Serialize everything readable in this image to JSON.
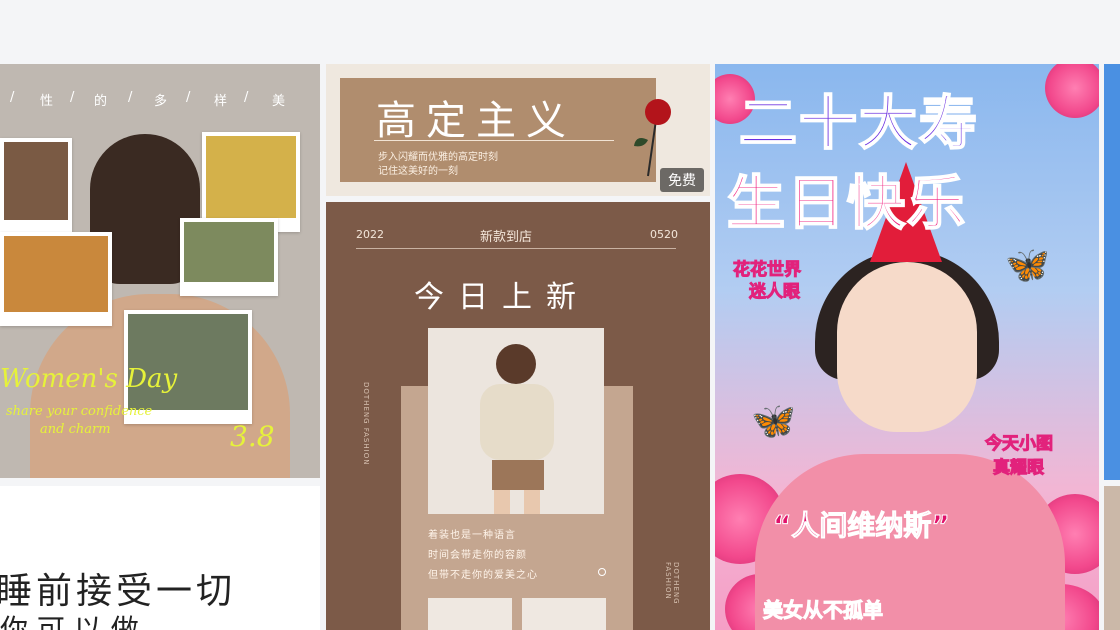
{
  "cards": {
    "womens_day": {
      "top_chars": [
        "/",
        "性",
        "/",
        "的",
        "/",
        "多",
        "/",
        "样",
        "/",
        "美"
      ],
      "script_title": "Women's Day",
      "script_sub1": "share your confidence",
      "script_sub2": "and charm",
      "date": "3.8"
    },
    "sleep_text": {
      "line1": "睡前接受一切",
      "line2": "你 可 以 做"
    },
    "haute": {
      "title": "高定主义",
      "sub1": "步入闪耀而优雅的高定时刻",
      "sub2": "记住这美好的一刻",
      "badge": "免费"
    },
    "new_arrival": {
      "year": "2022",
      "header": "新款到店",
      "date": "0520",
      "title": "今日上新",
      "copy": [
        "着装也是一种语言",
        "时间会带走你的容颜",
        "但带不走你的爱美之心"
      ],
      "vert_left": "DOTHENG FASHION",
      "vert_right": "DOTHENG FASHION"
    },
    "birthday": {
      "title1": "二十大寿",
      "title2": "生日快乐",
      "left_tag1": "花花世界",
      "left_tag2": "迷人眼",
      "right_tag1": "今天小图",
      "right_tag2": "真耀眼",
      "quote": "“人间维纳斯”",
      "bottom": "美女从不孤单"
    }
  }
}
